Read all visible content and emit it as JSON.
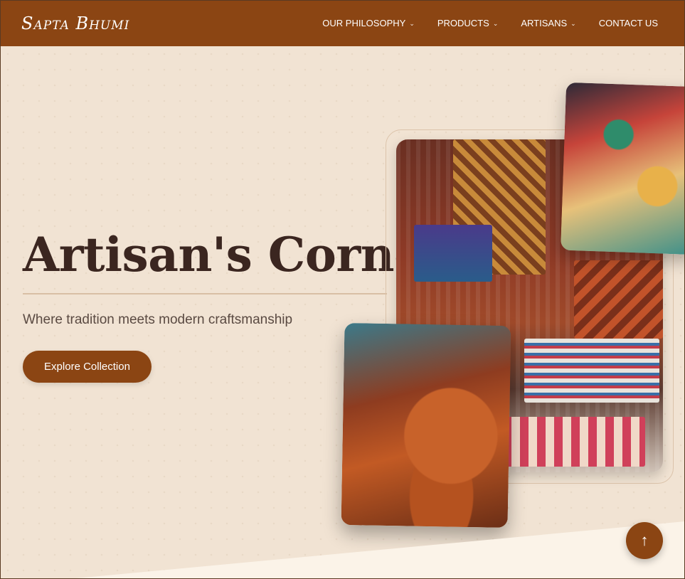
{
  "header": {
    "logo": "Sapta Bhumi",
    "nav": [
      {
        "label": "OUR PHILOSOPHY",
        "dropdown": true
      },
      {
        "label": "PRODUCTS",
        "dropdown": true
      },
      {
        "label": "ARTISANS",
        "dropdown": true
      },
      {
        "label": "CONTACT US",
        "dropdown": false
      }
    ],
    "chevron": "⌄"
  },
  "hero": {
    "title": "Artisan's Corner",
    "subtitle": "Where tradition meets modern craftsmanship",
    "cta": "Explore Collection"
  },
  "back_to_top": {
    "icon": "arrow-up-icon",
    "glyph": "↑"
  },
  "colors": {
    "brand": "#8b4513",
    "background": "#f1e3d3",
    "title": "#3b2620"
  }
}
